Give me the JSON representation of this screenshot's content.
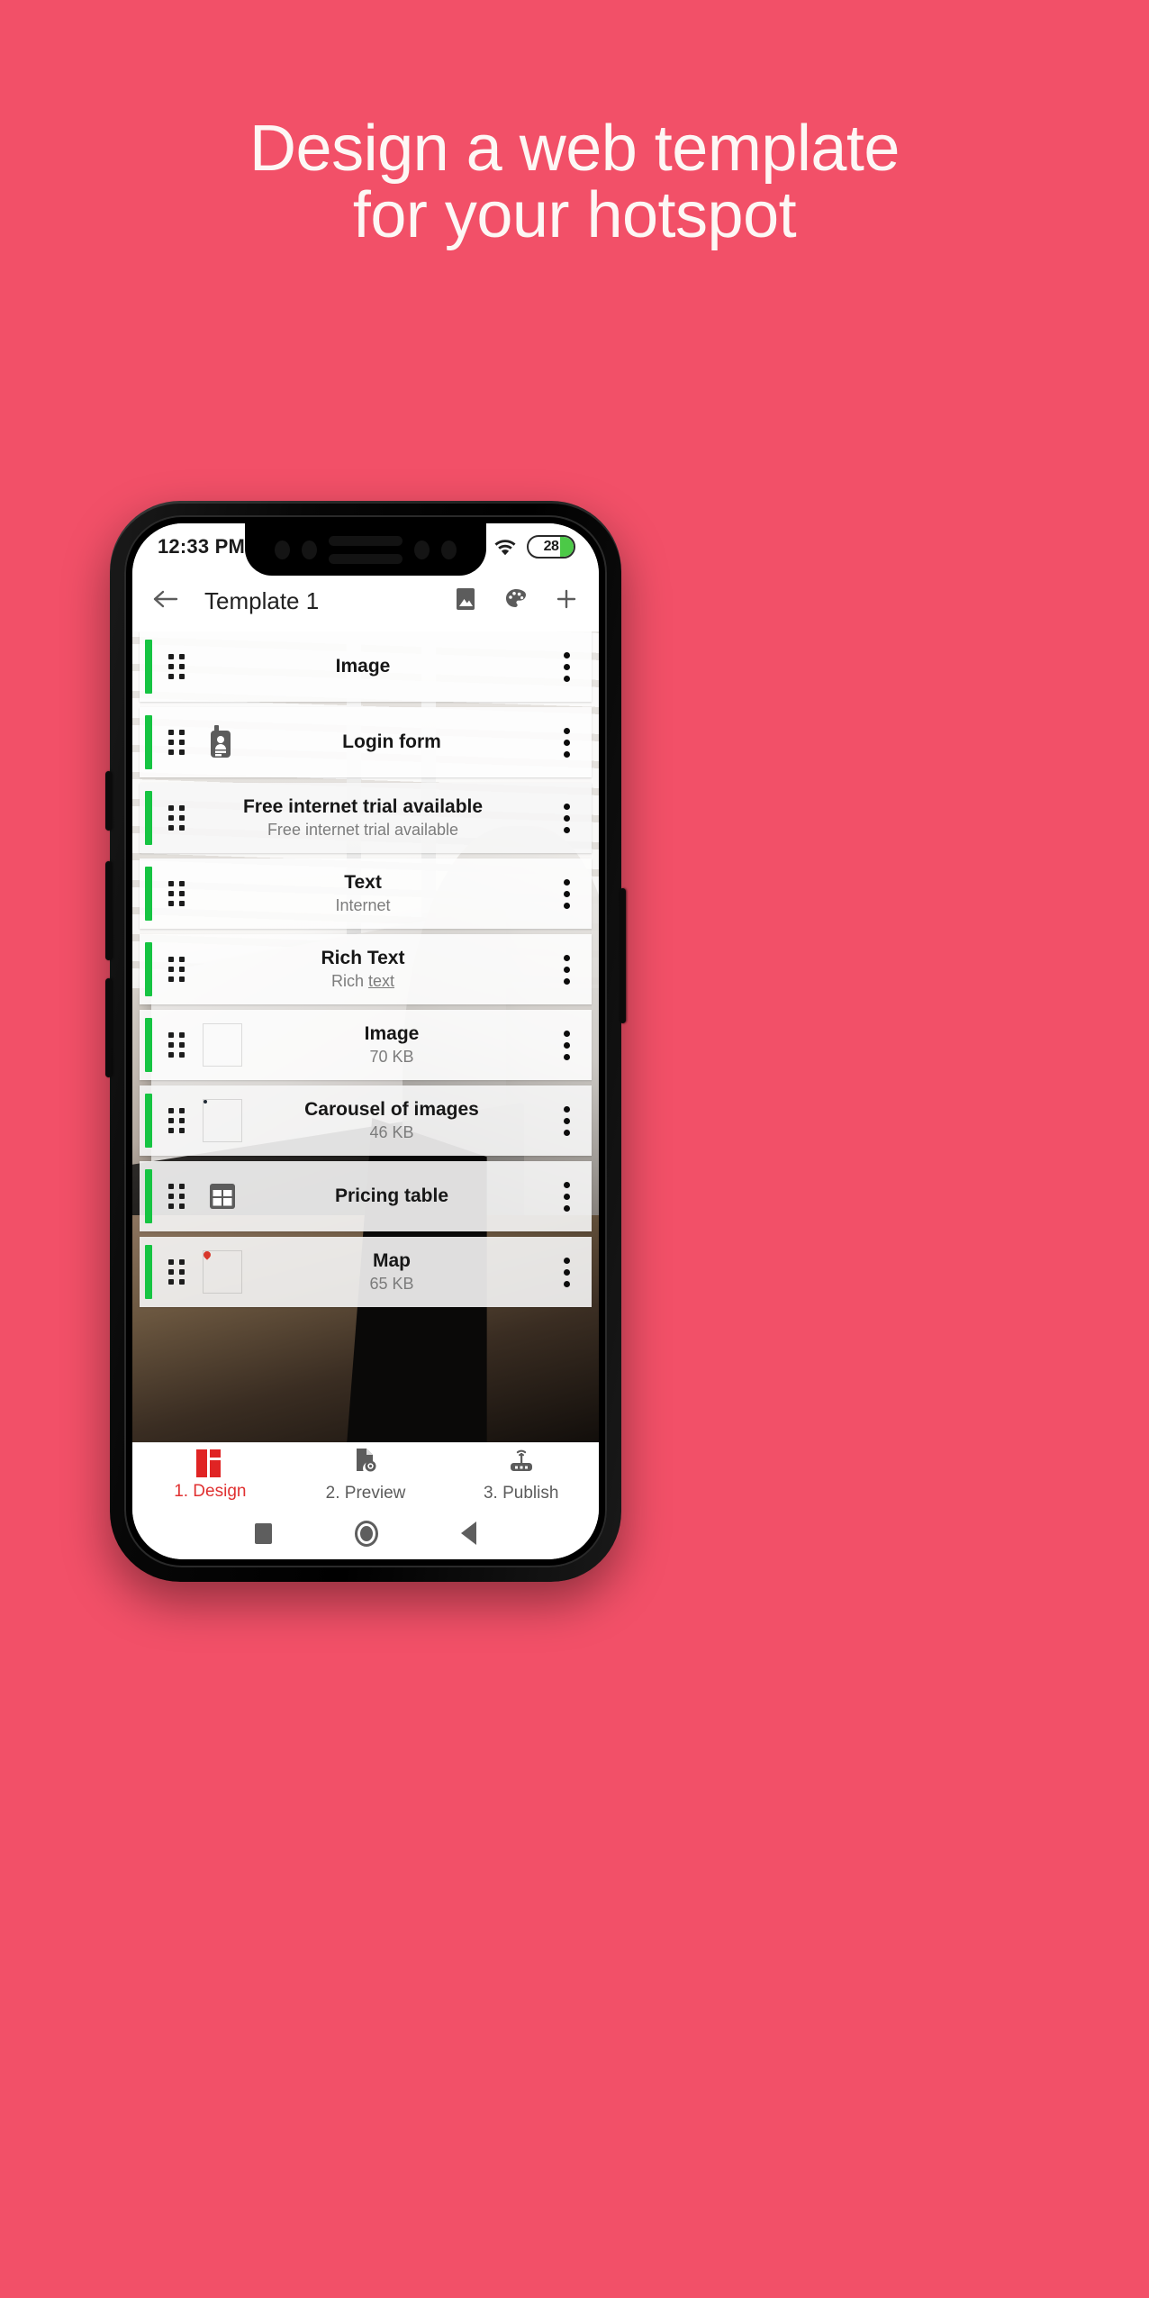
{
  "headline": {
    "line1": "Design a web template",
    "line2": "for your hotspot",
    "color": "#FDF7F5"
  },
  "background": {
    "color": "#F25068"
  },
  "statusbar": {
    "time": "12:33 PM",
    "airplane_icon": "airplane-mode-icon",
    "wifi_icon": "wifi-icon",
    "battery_level": "28"
  },
  "toolbar": {
    "back_icon": "back-arrow-icon",
    "title": "Template 1",
    "image_icon": "image-icon",
    "palette_icon": "palette-icon",
    "add_icon": "plus-icon"
  },
  "list": {
    "accent_color": "#16C442",
    "rows": [
      {
        "title": "Image",
        "subtitle": "",
        "icon": "",
        "thumb": ""
      },
      {
        "title": "Login form",
        "subtitle": "",
        "icon": "id-badge-icon",
        "thumb": ""
      },
      {
        "title": "Free internet trial available",
        "subtitle": "Free internet trial available",
        "icon": "",
        "thumb": ""
      },
      {
        "title": "Text",
        "subtitle": "Internet",
        "icon": "",
        "thumb": ""
      },
      {
        "title": "Rich Text",
        "subtitle": "Rich text",
        "icon": "",
        "thumb": "",
        "underline_from": 5
      },
      {
        "title": "Image",
        "subtitle": "70 KB",
        "icon": "",
        "thumb": "tower-thumbnail"
      },
      {
        "title": "Carousel of images",
        "subtitle": "46 KB",
        "icon": "",
        "thumb": "carousel-thumbnail"
      },
      {
        "title": "Pricing table",
        "subtitle": "",
        "icon": "table-grid-icon",
        "thumb": ""
      },
      {
        "title": "Map",
        "subtitle": "65 KB",
        "icon": "",
        "thumb": "map-thumbnail"
      }
    ]
  },
  "bottomnav": {
    "active_color": "#E03131",
    "items": [
      {
        "label": "1. Design",
        "icon": "design-blocks-icon",
        "active": true
      },
      {
        "label": "2. Preview",
        "icon": "document-preview-icon",
        "active": false
      },
      {
        "label": "3. Publish",
        "icon": "router-broadcast-icon",
        "active": false
      }
    ]
  },
  "androidnav": {
    "recents_icon": "square-recents-icon",
    "home_icon": "circle-home-icon",
    "back_icon": "triangle-back-icon"
  }
}
